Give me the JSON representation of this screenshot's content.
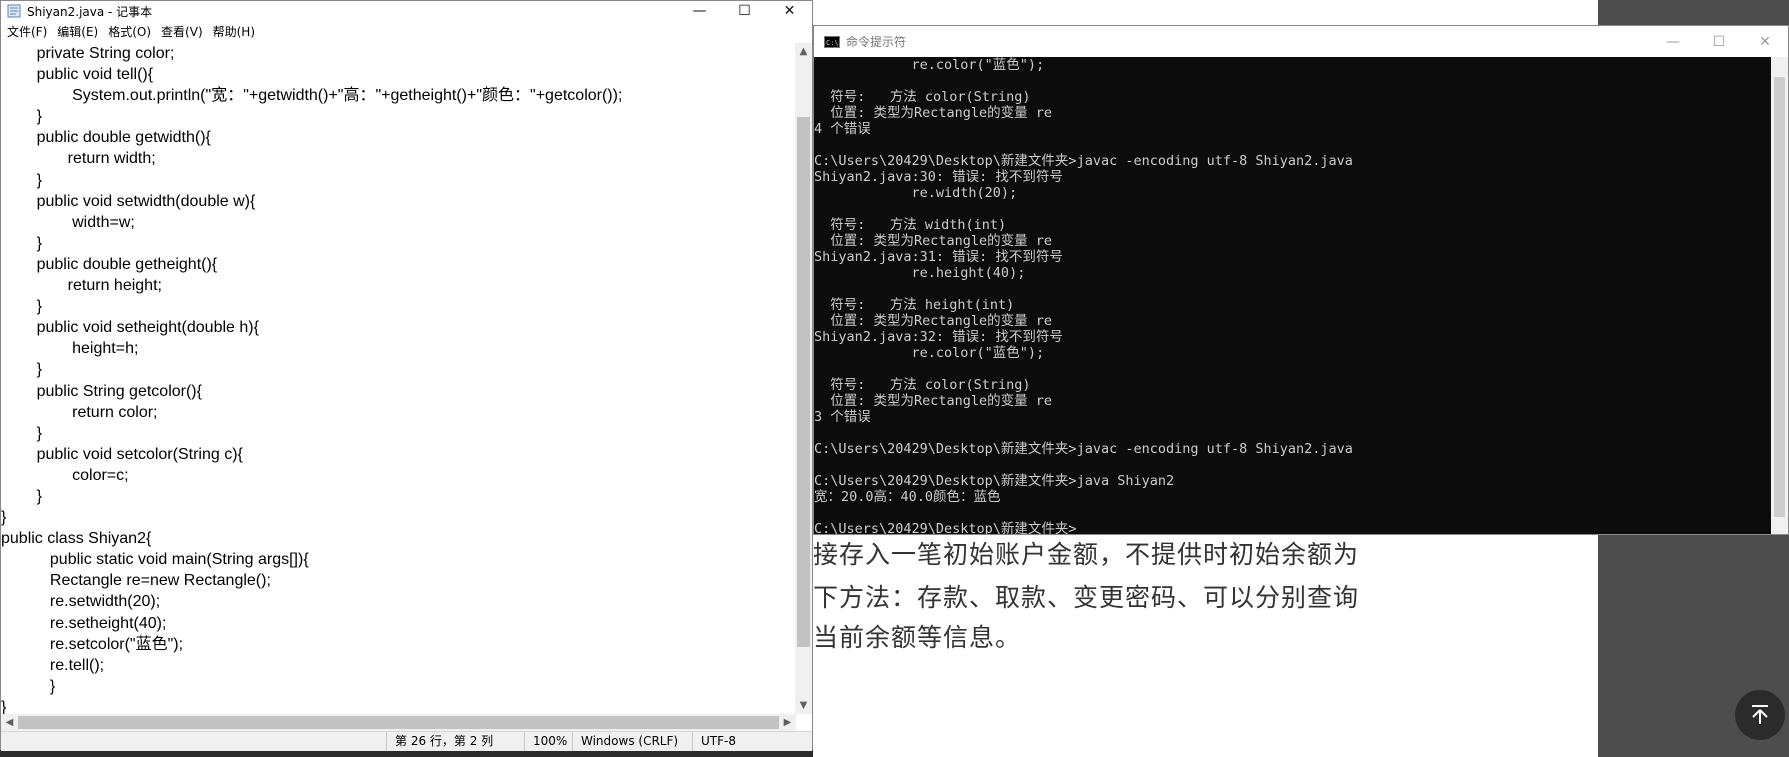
{
  "background_doc": {
    "lines": [
      "接存入一笔初始账户金额，不提供时初始余额为",
      "下方法：存款、取款、变更密码、可以分别查询",
      "当前余额等信息。"
    ]
  },
  "notepad": {
    "title": "Shiyan2.java - 记事本",
    "menu": [
      "文件(F)",
      "编辑(E)",
      "格式(O)",
      "查看(V)",
      "帮助(H)"
    ],
    "code_lines": [
      "        private String color;",
      "        public void tell(){",
      "                System.out.println(\"宽：\"+getwidth()+\"高：\"+getheight()+\"颜色：\"+getcolor());",
      "        }",
      "        public double getwidth(){",
      "               return width;",
      "        }",
      "        public void setwidth(double w){",
      "                width=w;",
      "        }",
      "        public double getheight(){",
      "               return height;",
      "        }",
      "        public void setheight(double h){",
      "                height=h;",
      "        }",
      "        public String getcolor(){",
      "                return color;",
      "        }",
      "        public void setcolor(String c){",
      "                color=c;",
      "        }",
      "}",
      "public class Shiyan2{",
      "           public static void main(String args[]){",
      "           Rectangle re=new Rectangle();",
      "           re.setwidth(20);",
      "           re.setheight(40);",
      "           re.setcolor(\"蓝色\");",
      "           re.tell();",
      "           }",
      "}"
    ],
    "status": {
      "position": "第 26 行，第 2 列",
      "zoom": "100%",
      "line_ending": "Windows (CRLF)",
      "encoding": "UTF-8"
    },
    "caption": {
      "minimize": "—",
      "maximize": "☐",
      "close": "✕"
    }
  },
  "cmd": {
    "title": "命令提示符",
    "lines": [
      "            re.color(\"蓝色\");",
      "",
      "  符号:   方法 color(String)",
      "  位置: 类型为Rectangle的变量 re",
      "4 个错误",
      "",
      "C:\\Users\\20429\\Desktop\\新建文件夹>javac -encoding utf-8 Shiyan2.java",
      "Shiyan2.java:30: 错误: 找不到符号",
      "            re.width(20);",
      "",
      "  符号:   方法 width(int)",
      "  位置: 类型为Rectangle的变量 re",
      "Shiyan2.java:31: 错误: 找不到符号",
      "            re.height(40);",
      "",
      "  符号:   方法 height(int)",
      "  位置: 类型为Rectangle的变量 re",
      "Shiyan2.java:32: 错误: 找不到符号",
      "            re.color(\"蓝色\");",
      "",
      "  符号:   方法 color(String)",
      "  位置: 类型为Rectangle的变量 re",
      "3 个错误",
      "",
      "C:\\Users\\20429\\Desktop\\新建文件夹>javac -encoding utf-8 Shiyan2.java",
      "",
      "C:\\Users\\20429\\Desktop\\新建文件夹>java Shiyan2",
      "宽：20.0高：40.0颜色：蓝色",
      "",
      "C:\\Users\\20429\\Desktop\\新建文件夹>"
    ],
    "caption": {
      "minimize": "—",
      "maximize": "☐",
      "close": "✕"
    }
  }
}
